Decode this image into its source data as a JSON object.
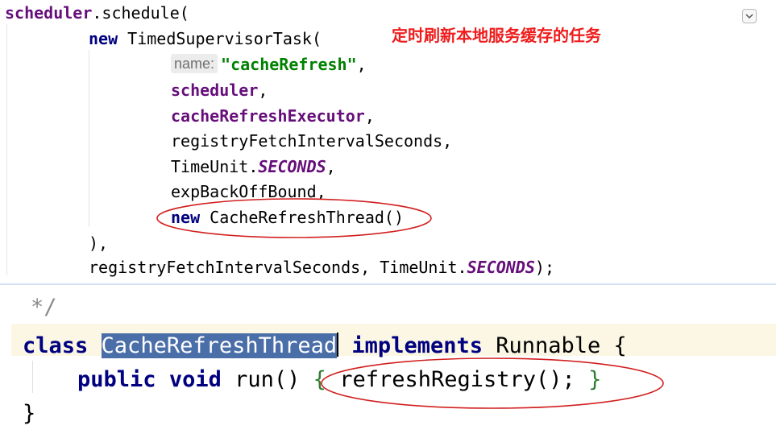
{
  "top": {
    "line1": {
      "obj": "scheduler",
      "rest": ".schedule("
    },
    "line2": {
      "kw": "new",
      "rest": " TimedSupervisorTask("
    },
    "line3": {
      "hint": "name:",
      "str": "\"cacheRefresh\"",
      "tail": ","
    },
    "line4": {
      "field": "scheduler",
      "tail": ","
    },
    "line5": {
      "field": "cacheRefreshExecutor",
      "tail": ","
    },
    "line6": {
      "text": "registryFetchIntervalSeconds,"
    },
    "line7": {
      "pre": "TimeUnit.",
      "const": "SECONDS",
      "tail": ","
    },
    "line8": {
      "text": "expBackOffBound,"
    },
    "line9": {
      "kw": "new",
      "rest": " CacheRefreshThread()"
    },
    "line10": {
      "text": "),"
    },
    "line11": {
      "pre": "registryFetchIntervalSeconds, TimeUnit.",
      "const": "SECONDS",
      "tail": ");"
    },
    "annotation": "定时刷新本地服务缓存的任务"
  },
  "bottom": {
    "comment": "*/",
    "class_line": {
      "kw_class": "class",
      "name": "CacheRefreshThread",
      "kw_implements": "implements",
      "iface": "Runnable {"
    },
    "run_line": {
      "kw_public": "public",
      "kw_void": "void",
      "method": "run()",
      "open_brace": "{",
      "body": "refreshRegistry();",
      "close_brace": "}"
    },
    "end_brace": "}"
  },
  "colors": {
    "keyword": "#000080",
    "field": "#660e7a",
    "string": "#008000",
    "annotation": "#ee1c1c",
    "selection": "#4a6ea8",
    "ellipse": "#d21f1f"
  },
  "icons": {
    "collapse": "chevron-down-icon"
  }
}
